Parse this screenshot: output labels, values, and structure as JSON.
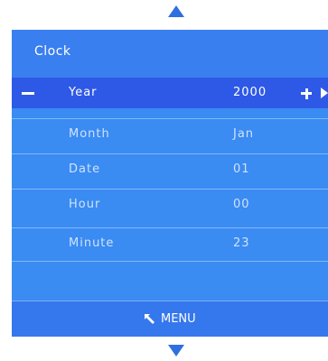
{
  "osd": {
    "title": "Clock",
    "rows": [
      {
        "label": "Year",
        "value": "2000",
        "selected": true
      },
      {
        "label": "Month",
        "value": "Jan"
      },
      {
        "label": "Date",
        "value": "01"
      },
      {
        "label": "Hour",
        "value": "00"
      },
      {
        "label": "Minute",
        "value": "23"
      }
    ],
    "footer": {
      "menu_label": "MENU"
    }
  },
  "colors": {
    "panel": "#3a8bf2",
    "header": "#3a7ff0",
    "selected_row": "#2e59e6",
    "footer": "#3577ec",
    "arrows": "#2f6fe0",
    "text": "#ffffff"
  },
  "icons": {
    "scroll_up": "triangle-up-icon",
    "scroll_down": "triangle-down-icon",
    "decrease_left": "triangle-left-icon",
    "decrease": "minus-icon",
    "increase": "plus-icon",
    "increase_right": "triangle-right-icon",
    "menu": "return-arrow-icon"
  }
}
